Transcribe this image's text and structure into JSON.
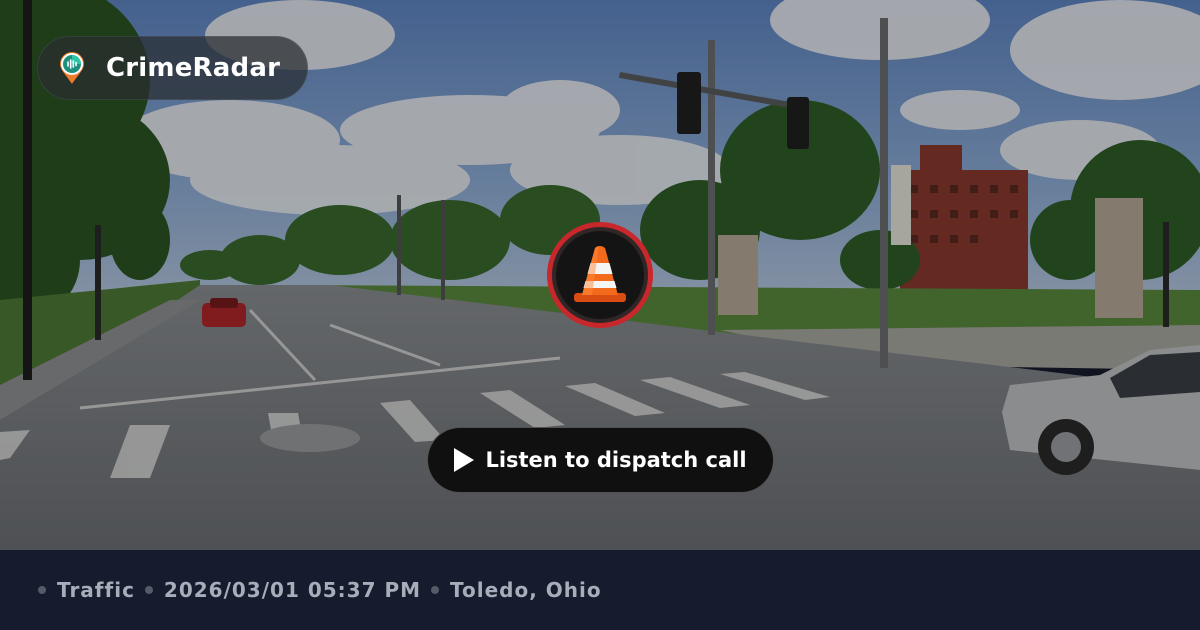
{
  "brand": {
    "name": "CrimeRadar",
    "logo_icon": "radar-pin-icon",
    "logo_colors": {
      "teal": "#2ec4a8",
      "orange": "#f07b2a",
      "ring": "#e6e6e6"
    }
  },
  "incident": {
    "icon": "traffic-cone-icon",
    "badge_color": "#c8272b"
  },
  "action": {
    "label": "Listen to dispatch call",
    "icon": "play-icon"
  },
  "meta": {
    "category": "Traffic",
    "datetime": "2026/03/01 05:37 PM",
    "location": "Toledo, Ohio"
  },
  "colors": {
    "footer_bg": "#161c2d",
    "footer_text": "#a7adb9",
    "separator_dot": "#555b68"
  }
}
